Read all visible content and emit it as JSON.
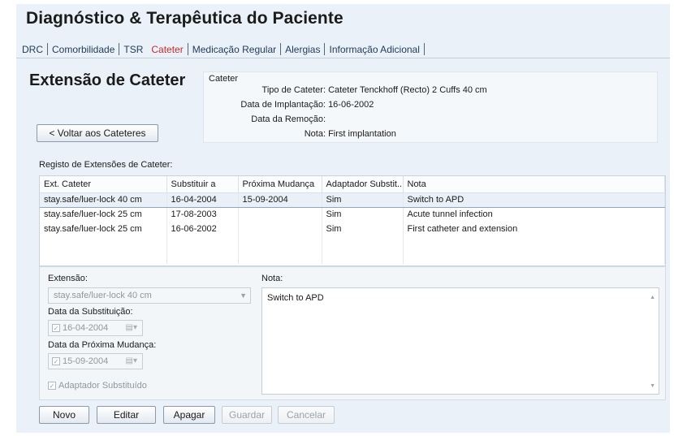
{
  "page": {
    "title": "Diagnóstico & Terapêutica do Paciente"
  },
  "tabs": [
    {
      "label": "DRC",
      "active": false
    },
    {
      "label": "Comorbilidade",
      "active": false
    },
    {
      "label": "TSR",
      "active": false
    },
    {
      "label": "Cateter",
      "active": true
    },
    {
      "label": "Medicação Regular",
      "active": false
    },
    {
      "label": "Alergias",
      "active": false
    },
    {
      "label": "Informação Adicional",
      "active": false
    }
  ],
  "section": {
    "title": "Extensão de Cateter",
    "back_button": "< Voltar aos Cateteres"
  },
  "catheter": {
    "legend": "Cateter",
    "type_label": "Tipo de Cateter:",
    "type_value": "Cateter Tenckhoff (Recto) 2 Cuffs 40 cm",
    "implant_label": "Data de Implantação:",
    "implant_value": "16-06-2002",
    "removal_label": "Data da Remoção:",
    "removal_value": "",
    "note_label": "Nota:",
    "note_value": "First implantation"
  },
  "registry": {
    "label": "Registo de Extensões de Cateter:",
    "columns": [
      "Ext. Cateter",
      "Substituir a",
      "Próxima Mudança",
      "Adaptador Substit...",
      "Nota"
    ],
    "rows": [
      [
        "stay.safe/luer-lock 40 cm",
        "16-04-2004",
        "15-09-2004",
        "Sim",
        "Switch to APD"
      ],
      [
        "stay.safe/luer-lock 25 cm",
        "17-08-2003",
        "",
        "Sim",
        "Acute tunnel infection"
      ],
      [
        "stay.safe/luer-lock 25 cm",
        "16-06-2002",
        "",
        "Sim",
        "First catheter and extension"
      ]
    ]
  },
  "detail": {
    "extension_label": "Extensão:",
    "extension_value": "stay.safe/luer-lock 40 cm",
    "subst_date_label": "Data da Substituição:",
    "subst_date_value": "16-04-2004",
    "next_change_label": "Data da Próxima Mudança:",
    "next_change_value": "15-09-2004",
    "adapter_label": "Adaptador Substituído",
    "note_label": "Nota:",
    "note_value": "Switch to APD"
  },
  "buttons": {
    "new": "Novo",
    "edit": "Editar",
    "delete": "Apagar",
    "save": "Guardar",
    "cancel": "Cancelar"
  }
}
